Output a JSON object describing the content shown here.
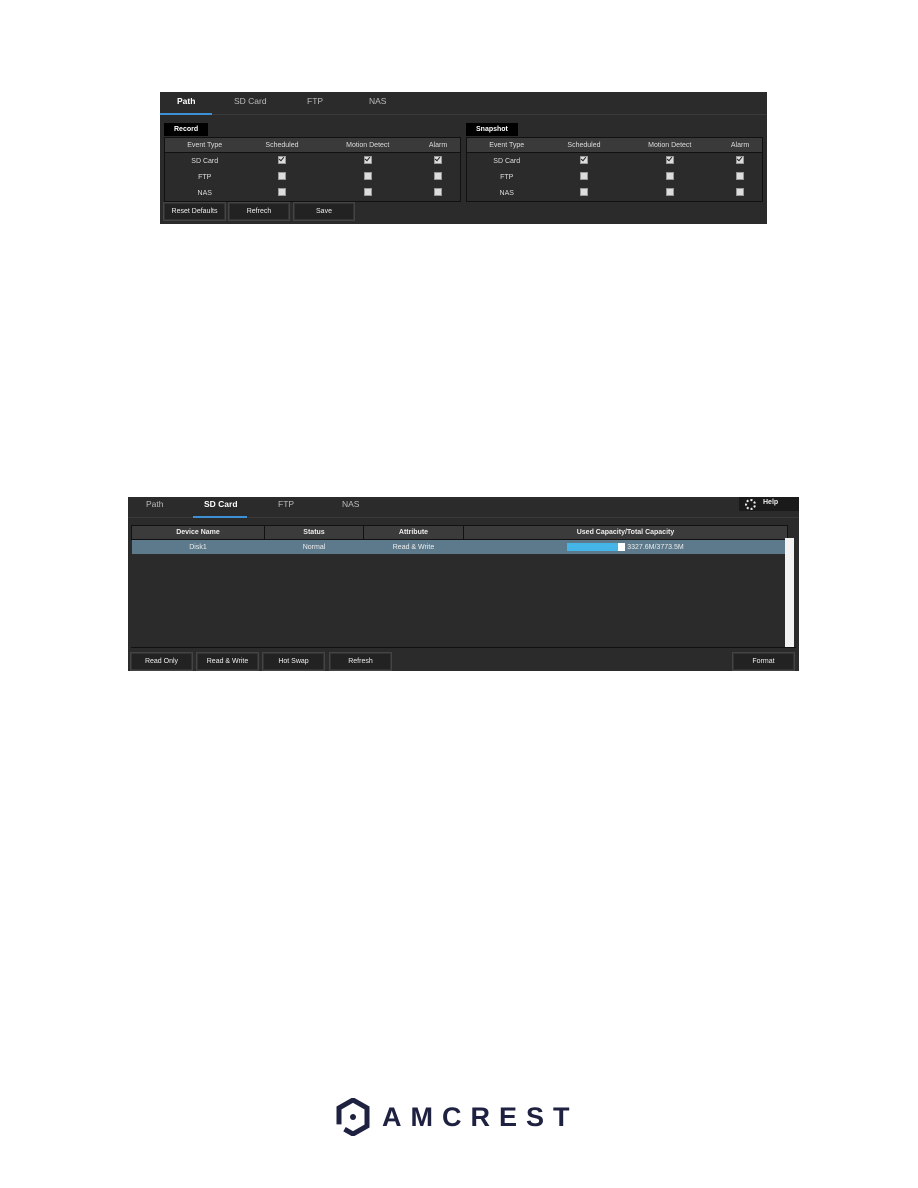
{
  "panel1": {
    "tabs": [
      "Path",
      "SD Card",
      "FTP",
      "NAS"
    ],
    "active_tab": "Path",
    "record": {
      "label": "Record",
      "headers": [
        "Event Type",
        "Scheduled",
        "Motion Detect",
        "Alarm"
      ],
      "rows": [
        {
          "type": "SD Card",
          "checks": [
            true,
            true,
            true
          ]
        },
        {
          "type": "FTP",
          "checks": [
            false,
            false,
            false
          ]
        },
        {
          "type": "NAS",
          "checks": [
            false,
            false,
            false
          ]
        }
      ]
    },
    "snapshot": {
      "label": "Snapshot",
      "headers": [
        "Event Type",
        "Scheduled",
        "Motion Detect",
        "Alarm"
      ],
      "rows": [
        {
          "type": "SD Card",
          "checks": [
            true,
            true,
            true
          ]
        },
        {
          "type": "FTP",
          "checks": [
            false,
            false,
            false
          ]
        },
        {
          "type": "NAS",
          "checks": [
            false,
            false,
            false
          ]
        }
      ]
    },
    "buttons": {
      "reset": "Reset Defaults",
      "refresh": "Refrech",
      "save": "Save"
    }
  },
  "panel2": {
    "tabs": [
      "Path",
      "SD Card",
      "FTP",
      "NAS"
    ],
    "active_tab": "SD Card",
    "help_label": "Help",
    "headers": [
      "Device Name",
      "Status",
      "Attribute",
      "Used Capacity/Total Capacity"
    ],
    "rows": [
      {
        "device": "Disk1",
        "status": "Normal",
        "attribute": "Read & Write",
        "capacity_text": "3327.6M/3773.5M",
        "used_fraction": 0.88
      }
    ],
    "buttons": {
      "read_only": "Read Only",
      "read_write": "Read & Write",
      "hot_swap": "Hot Swap",
      "refresh": "Refresh",
      "format": "Format"
    }
  },
  "brand": {
    "name": "AMCREST",
    "color": "#1e2140"
  }
}
